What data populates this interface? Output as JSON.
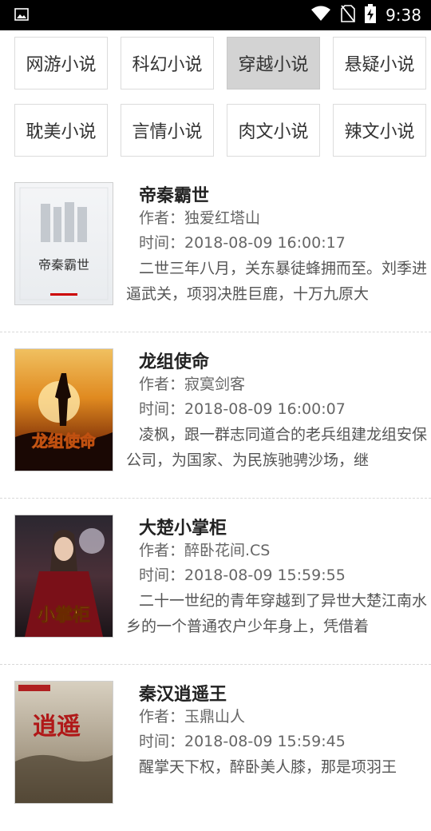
{
  "status_bar": {
    "time": "9:38",
    "icons": [
      "image-icon",
      "wifi-icon",
      "no-sim-icon",
      "battery-charging-icon"
    ]
  },
  "categories": [
    {
      "label": "网游小说",
      "active": false
    },
    {
      "label": "科幻小说",
      "active": false
    },
    {
      "label": "穿越小说",
      "active": true
    },
    {
      "label": "悬疑小说",
      "active": false
    },
    {
      "label": "耽美小说",
      "active": false
    },
    {
      "label": "言情小说",
      "active": false
    },
    {
      "label": "肉文小说",
      "active": false
    },
    {
      "label": "辣文小说",
      "active": false
    }
  ],
  "books": [
    {
      "title": "帝秦霸世",
      "author": "作者：独爱红塔山",
      "time": "时间：2018-08-09 16:00:17",
      "description": "二世三年八月，关东暴徒蜂拥而至。刘季进逼武关，项羽决胜巨鹿，十万九原大",
      "cover_text": "帝秦霸世"
    },
    {
      "title": "龙组使命",
      "author": "作者：寂寞剑客",
      "time": "时间：2018-08-09 16:00:07",
      "description": "凌枫，跟一群志同道合的老兵组建龙组安保公司，为国家、为民族驰骋沙场，继",
      "cover_text": "龙组使命"
    },
    {
      "title": "大楚小掌柜",
      "author": "作者：醉卧花间.CS",
      "time": "时间：2018-08-09 15:59:55",
      "description": "二十一世纪的青年穿越到了异世大楚江南水乡的一个普通农户少年身上，凭借着",
      "cover_text": "小掌柜"
    },
    {
      "title": "秦汉逍遥王",
      "author": "作者：玉鼎山人",
      "time": "时间：2018-08-09 15:59:45",
      "description": "醒掌天下权，醉卧美人膝，那是项羽王",
      "cover_text": "逍遥"
    }
  ],
  "colors": {
    "active_category_bg": "#d3d3d3",
    "status_bar_bg": "#000000"
  }
}
